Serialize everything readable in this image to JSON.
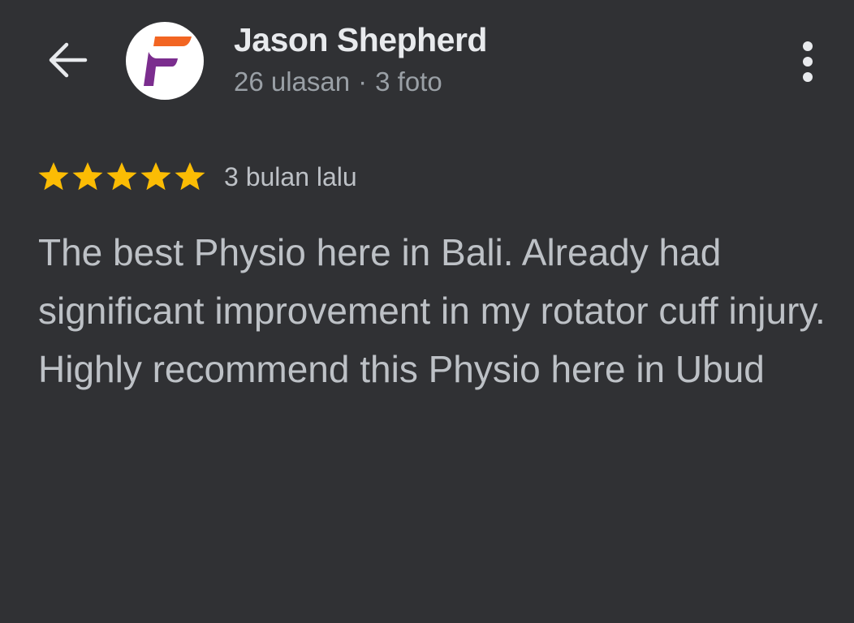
{
  "header": {
    "back_icon": "arrow-left-icon",
    "avatar_icon": "brand-f-logo",
    "reviewer_name": "Jason Shepherd",
    "review_count": "26 ulasan",
    "separator": "·",
    "photo_count": "3 foto",
    "more_icon": "more-vertical-icon"
  },
  "review": {
    "rating": 5,
    "max_rating": 5,
    "date": "3 bulan lalu",
    "text": "The best Physio here in Bali. Already had significant improvement in my rotator cuff injury. Highly recommend this Physio here in Ubud"
  },
  "colors": {
    "background": "#303134",
    "star": "#fbbc04",
    "logo_orange": "#f26522",
    "logo_purple": "#7b2d8e"
  }
}
